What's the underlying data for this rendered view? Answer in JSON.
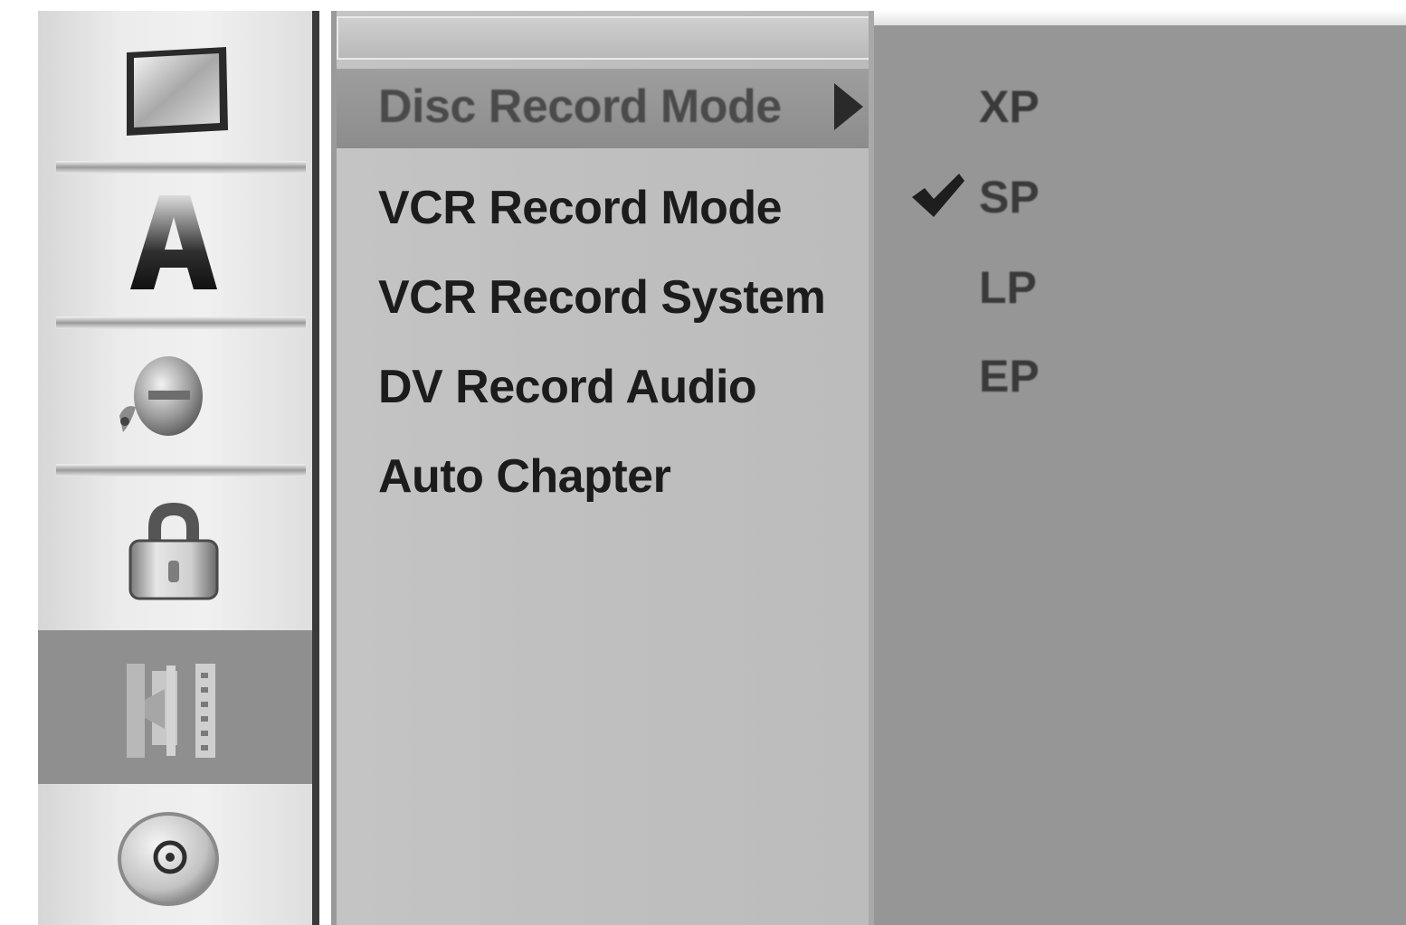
{
  "categories": [
    {
      "name": "tv-screen-icon",
      "selected": false
    },
    {
      "name": "language-a-icon",
      "selected": false
    },
    {
      "name": "audio-speaker-icon",
      "selected": false
    },
    {
      "name": "lock-icon",
      "selected": false
    },
    {
      "name": "film-record-icon",
      "selected": true
    },
    {
      "name": "disc-icon",
      "selected": false
    }
  ],
  "menu": {
    "items": [
      {
        "label": "Disc Record Mode",
        "selected": true
      },
      {
        "label": "VCR Record Mode",
        "selected": false
      },
      {
        "label": "VCR Record System",
        "selected": false
      },
      {
        "label": "DV Record Audio",
        "selected": false
      },
      {
        "label": "Auto Chapter",
        "selected": false
      }
    ]
  },
  "options": {
    "items": [
      {
        "label": "XP",
        "checked": false
      },
      {
        "label": "SP",
        "checked": true
      },
      {
        "label": "LP",
        "checked": false
      },
      {
        "label": "EP",
        "checked": false
      }
    ]
  },
  "colors": {
    "highlight": "#8f8f8f",
    "menu_bg": "#c0c0c0",
    "options_bg": "#969696",
    "text": "#1c1c1c"
  }
}
